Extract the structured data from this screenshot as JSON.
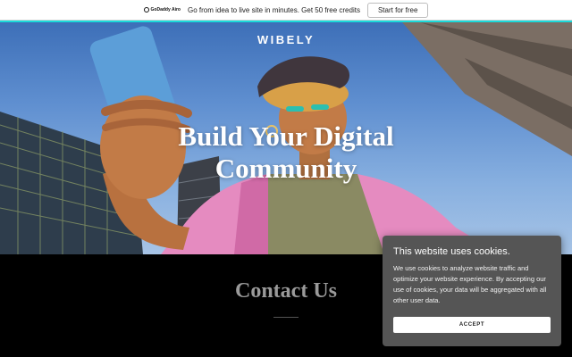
{
  "promo_bar": {
    "brand": "GoDaddy Airo",
    "message": "Go from idea to live site in minutes. Get 50 free credits",
    "cta_label": "Start for free",
    "accent_color": "#1bdbdb"
  },
  "header": {
    "site_name": "WIBELY"
  },
  "hero": {
    "title": "Build Your Digital Community"
  },
  "contact": {
    "heading": "Contact Us"
  },
  "cookie_banner": {
    "title": "This website uses cookies.",
    "body": "We use cookies to analyze website traffic and optimize your website experience. By accepting our use of cookies, your data will be aggregated with all other user data.",
    "accept_label": "ACCEPT",
    "background_color": "#555555"
  }
}
